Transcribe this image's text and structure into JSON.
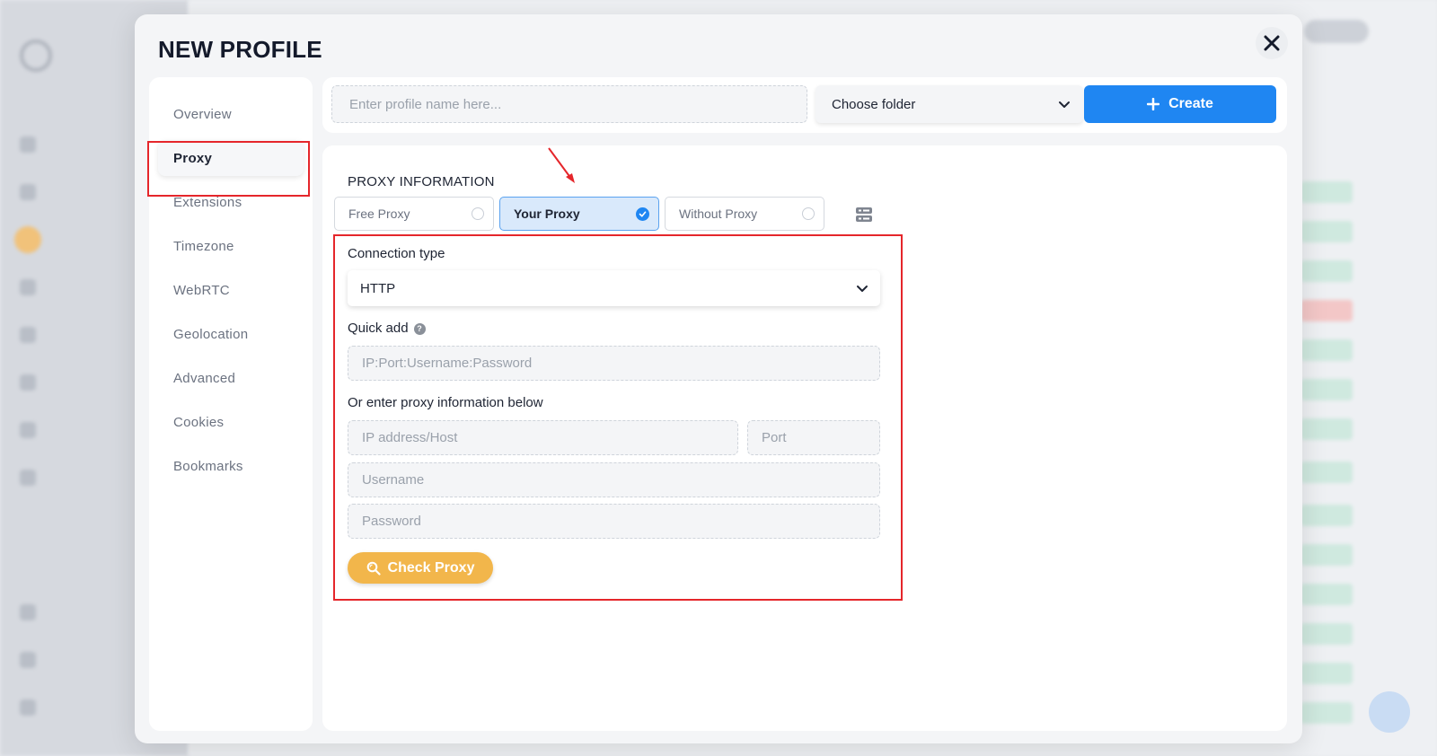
{
  "modal": {
    "title": "NEW PROFILE"
  },
  "side_nav": {
    "items": [
      {
        "label": "Overview",
        "name": "overview"
      },
      {
        "label": "Proxy",
        "name": "proxy",
        "active": true
      },
      {
        "label": "Extensions",
        "name": "extensions"
      },
      {
        "label": "Timezone",
        "name": "timezone"
      },
      {
        "label": "WebRTC",
        "name": "webrtc"
      },
      {
        "label": "Geolocation",
        "name": "geolocation"
      },
      {
        "label": "Advanced",
        "name": "advanced"
      },
      {
        "label": "Cookies",
        "name": "cookies"
      },
      {
        "label": "Bookmarks",
        "name": "bookmarks"
      }
    ]
  },
  "topbar": {
    "name_placeholder": "Enter profile name here...",
    "folder_label": "Choose folder",
    "create_label": "Create"
  },
  "proxy": {
    "section_title": "PROXY INFORMATION",
    "options": [
      {
        "label": "Free Proxy",
        "selected": false
      },
      {
        "label": "Your Proxy",
        "selected": true
      },
      {
        "label": "Without Proxy",
        "selected": false
      }
    ],
    "connection_type_label": "Connection type",
    "connection_type_value": "HTTP",
    "quick_add_label": "Quick add",
    "quick_add_placeholder": "IP:Port:Username:Password",
    "manual_label": "Or enter proxy information below",
    "host_placeholder": "IP address/Host",
    "port_placeholder": "Port",
    "username_placeholder": "Username",
    "password_placeholder": "Password",
    "check_label": "Check Proxy"
  },
  "colors": {
    "accent_blue": "#1f86f2",
    "check_orange": "#f2b64b",
    "highlight_red": "#e5262b"
  }
}
